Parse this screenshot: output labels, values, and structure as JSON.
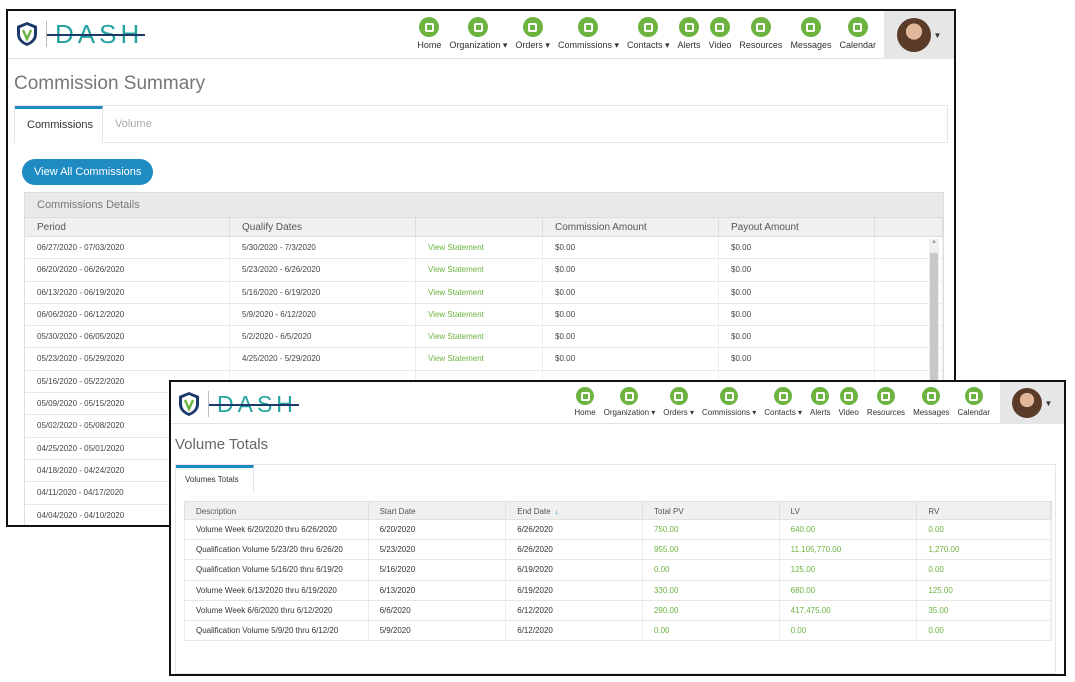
{
  "brand": {
    "name": "DASH"
  },
  "nav": [
    {
      "label": "Home",
      "icon": "home-icon"
    },
    {
      "label": "Organization ▾",
      "icon": "organization-icon"
    },
    {
      "label": "Orders ▾",
      "icon": "orders-icon"
    },
    {
      "label": "Commissions ▾",
      "icon": "commissions-icon"
    },
    {
      "label": "Contacts ▾",
      "icon": "contacts-icon"
    },
    {
      "label": "Alerts",
      "icon": "bell-icon"
    },
    {
      "label": "Video",
      "icon": "video-icon"
    },
    {
      "label": "Resources",
      "icon": "resources-icon"
    },
    {
      "label": "Messages",
      "icon": "envelope-icon"
    },
    {
      "label": "Calendar",
      "icon": "calendar-icon"
    }
  ],
  "commission": {
    "title": "Commission Summary",
    "tabs": [
      "Commissions",
      "Volume"
    ],
    "view_all_label": "View All Commissions",
    "panel_title": "Commissions Details",
    "columns": [
      "Period",
      "Qualify Dates",
      "",
      "Commission Amount",
      "Payout Amount"
    ],
    "rows": [
      {
        "period": "06/27/2020 - 07/03/2020",
        "qualify": "5/30/2020 - 7/3/2020",
        "link": "View Statement",
        "commission": "$0.00",
        "payout": "$0.00"
      },
      {
        "period": "06/20/2020 - 06/26/2020",
        "qualify": "5/23/2020 - 6/26/2020",
        "link": "View Statement",
        "commission": "$0.00",
        "payout": "$0.00"
      },
      {
        "period": "06/13/2020 - 06/19/2020",
        "qualify": "5/16/2020 - 6/19/2020",
        "link": "View Statement",
        "commission": "$0.00",
        "payout": "$0.00"
      },
      {
        "period": "06/06/2020 - 06/12/2020",
        "qualify": "5/9/2020 - 6/12/2020",
        "link": "View Statement",
        "commission": "$0.00",
        "payout": "$0.00"
      },
      {
        "period": "05/30/2020 - 06/05/2020",
        "qualify": "5/2/2020 - 6/5/2020",
        "link": "View Statement",
        "commission": "$0.00",
        "payout": "$0.00"
      },
      {
        "period": "05/23/2020 - 05/29/2020",
        "qualify": "4/25/2020 - 5/29/2020",
        "link": "View Statement",
        "commission": "$0.00",
        "payout": "$0.00"
      },
      {
        "period": "05/16/2020 - 05/22/2020",
        "qualify": "",
        "link": "",
        "commission": "",
        "payout": ""
      },
      {
        "period": "05/09/2020 - 05/15/2020",
        "qualify": "",
        "link": "",
        "commission": "",
        "payout": ""
      },
      {
        "period": "05/02/2020 - 05/08/2020",
        "qualify": "",
        "link": "",
        "commission": "",
        "payout": ""
      },
      {
        "period": "04/25/2020 - 05/01/2020",
        "qualify": "",
        "link": "",
        "commission": "",
        "payout": ""
      },
      {
        "period": "04/18/2020 - 04/24/2020",
        "qualify": "",
        "link": "",
        "commission": "",
        "payout": ""
      },
      {
        "period": "04/11/2020 - 04/17/2020",
        "qualify": "",
        "link": "",
        "commission": "",
        "payout": ""
      },
      {
        "period": "04/04/2020 - 04/10/2020",
        "qualify": "",
        "link": "",
        "commission": "",
        "payout": ""
      }
    ]
  },
  "volume": {
    "title": "Volume Totals",
    "tab": "Volumes Totals",
    "columns": [
      "Description",
      "Start Date",
      "End Date",
      "Total PV",
      "LV",
      "RV"
    ],
    "sort_glyph": "↓",
    "rows": [
      {
        "description": "Volume Week 6/20/2020 thru 6/26/2020",
        "start": "6/20/2020",
        "end": "6/26/2020",
        "total_pv": "750.00",
        "lv": "640.00",
        "rv": "0.00"
      },
      {
        "description": "Qualification Volume 5/23/20 thru 6/26/20",
        "start": "5/23/2020",
        "end": "6/26/2020",
        "total_pv": "955.00",
        "lv": "11,105,770.00",
        "rv": "1,270.00"
      },
      {
        "description": "Qualification Volume 5/16/20 thru 6/19/20",
        "start": "5/16/2020",
        "end": "6/19/2020",
        "total_pv": "0.00",
        "lv": "125.00",
        "rv": "0.00"
      },
      {
        "description": "Volume Week 6/13/2020 thru 6/19/2020",
        "start": "6/13/2020",
        "end": "6/19/2020",
        "total_pv": "330.00",
        "lv": "680.00",
        "rv": "125.00"
      },
      {
        "description": "Volume Week 6/6/2020 thru 6/12/2020",
        "start": "6/6/2020",
        "end": "6/12/2020",
        "total_pv": "290.00",
        "lv": "417,475.00",
        "rv": "35.00"
      },
      {
        "description": "Qualification Volume 5/9/20 thru 6/12/20",
        "start": "5/9/2020",
        "end": "6/12/2020",
        "total_pv": "0.00",
        "lv": "0.00",
        "rv": "0.00"
      }
    ]
  },
  "colors": {
    "accent_blue": "#1e8bc3",
    "brand_green": "#6cb33f",
    "logo_teal": "#25a3a0"
  }
}
